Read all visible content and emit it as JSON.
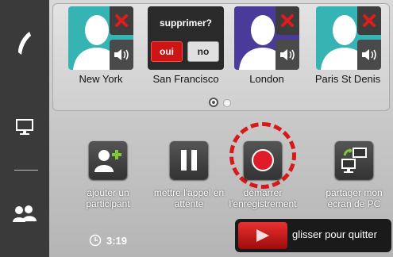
{
  "sidebar": {
    "items": [
      {
        "name": "phone-icon"
      },
      {
        "name": "monitor-icon"
      },
      {
        "name": "group-icon"
      }
    ]
  },
  "participants": [
    {
      "city": "New York",
      "avatar_color": "#36b4b3"
    },
    {
      "city": "San Francisco"
    },
    {
      "city": "London",
      "avatar_color": "#4a3a9a"
    },
    {
      "city": "Paris St Denis",
      "avatar_color": "#36b4b3"
    }
  ],
  "confirm_dialog": {
    "question": "supprimer?",
    "yes_label": "oui",
    "no_label": "no"
  },
  "pager": {
    "pages": 2,
    "current": 1
  },
  "actions": [
    {
      "label": "ajouter un participant"
    },
    {
      "label": "mettre l'appel en attente"
    },
    {
      "label": "démarrer l'enregistrement"
    },
    {
      "label": "partager mon écran de PC"
    }
  ],
  "call_timer": "3:19",
  "slide_to_quit": "glisser pour quitter",
  "colors": {
    "accent_red": "#d81919",
    "teal": "#36b4b3",
    "purple": "#4a3a9a",
    "add_green": "#7ec83a"
  }
}
